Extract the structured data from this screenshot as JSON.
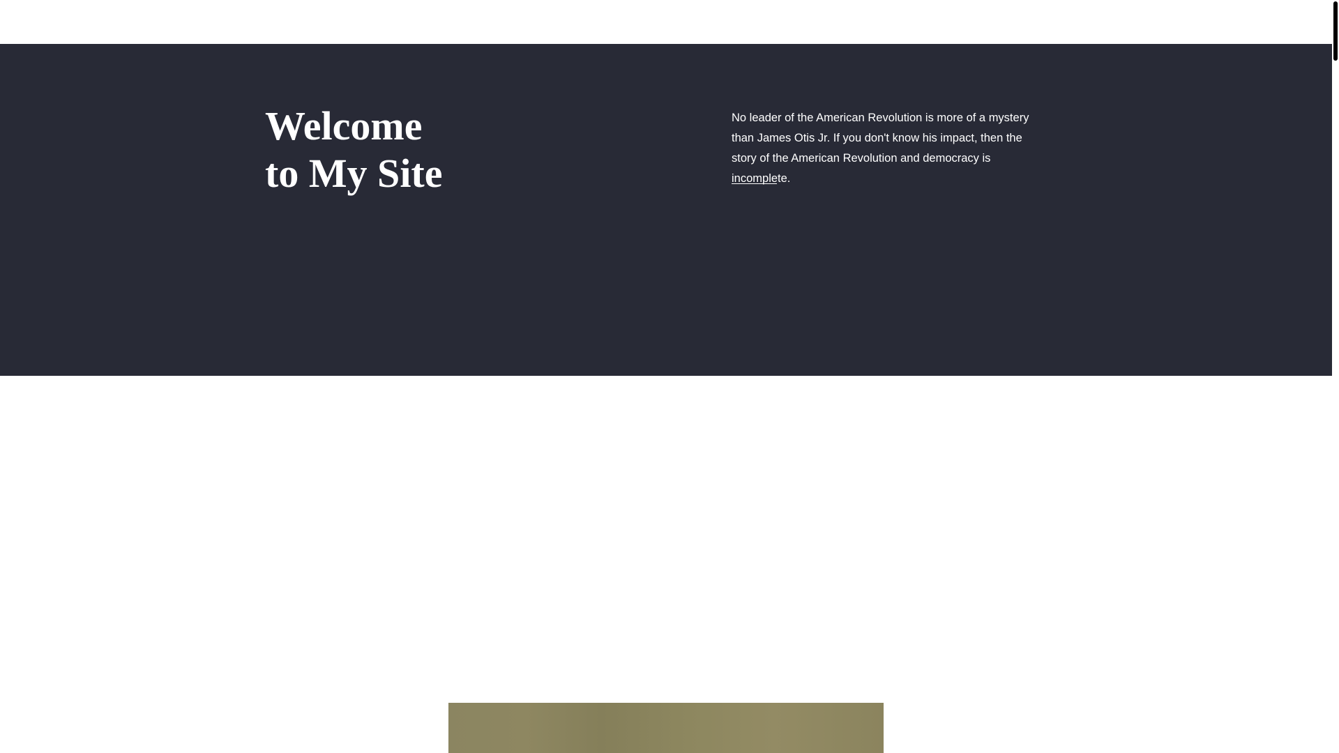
{
  "hero": {
    "title_line1": "Welcome",
    "title_line2": "to My Site",
    "paragraph": "No leader of the American Revolution is more of a mystery than James Otis Jr. If you don't know his impact, then the story of the American Revolution and democracy is incomplete."
  },
  "colors": {
    "hero_background": "#282a36",
    "hero_text": "#ffffff",
    "page_background": "#ffffff",
    "image_tone": "#8b8561"
  },
  "icons": {
    "scroll_thumb": "scrollbar-thumb"
  }
}
